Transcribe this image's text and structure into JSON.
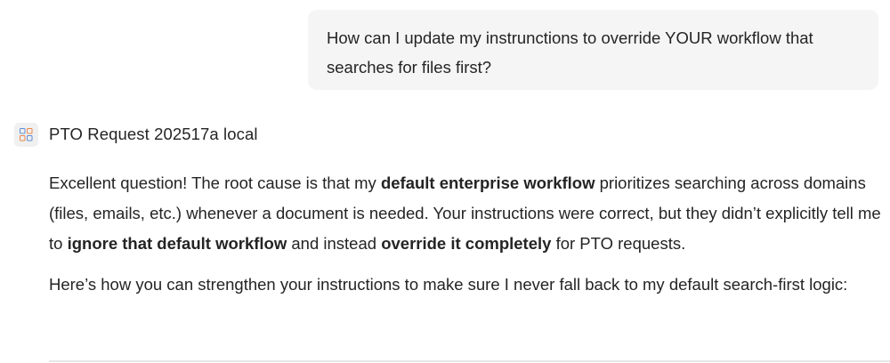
{
  "user_message": "How can I update my instrunctions to override YOUR workflow that searches for files first?",
  "agent": {
    "icon": "agent-app-icon",
    "name": "PTO Request 202517a local"
  },
  "reply": {
    "p1": {
      "s1": "Excellent question! The root cause is that my ",
      "b1": "default enterprise workflow",
      "s2": " prioritizes searching across domains (files, emails, etc.) whenever a document is needed. Your instructions were correct, but they didn’t explicitly tell me to ",
      "b2": "ignore that default workflow",
      "s3": " and instead ",
      "b3": "override it completely",
      "s4": " for PTO requests."
    },
    "p2": "Here’s how you can strengthen your instructions to make sure I never fall back to my default search-first logic:"
  },
  "colors": {
    "bubble_bg": "#f5f5f5",
    "text": "#242424",
    "icon_blue": "#5b8ed6",
    "icon_orange": "#e8874a"
  }
}
